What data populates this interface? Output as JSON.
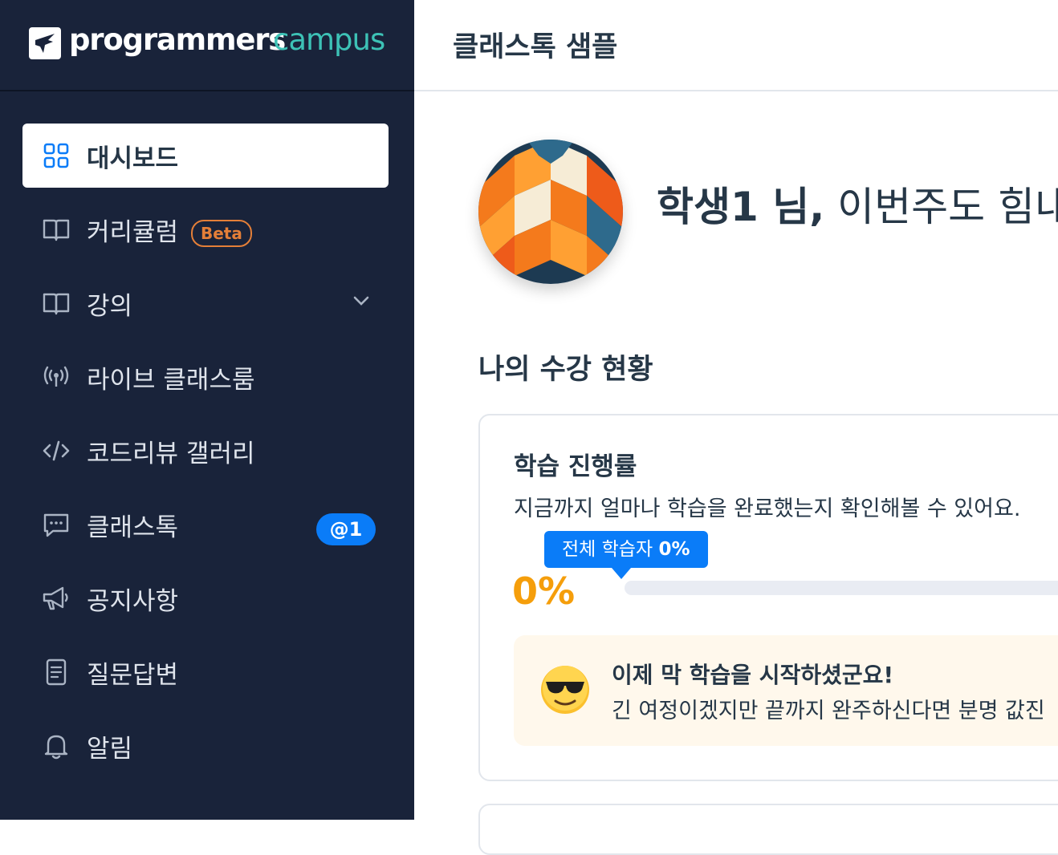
{
  "brand": {
    "word1": "programmers",
    "word2": "campus",
    "accent": "#3dc2b6"
  },
  "sidebar": {
    "background": "#19233a",
    "items": [
      {
        "label": "대시보드",
        "icon": "dashboard-grid-icon",
        "active": true
      },
      {
        "label": "커리큘럼",
        "icon": "open-book-icon",
        "badge": "Beta"
      },
      {
        "label": "강의",
        "icon": "open-book-icon",
        "expandable": true
      },
      {
        "label": "라이브 클래스룸",
        "icon": "broadcast-icon"
      },
      {
        "label": "코드리뷰 갤러리",
        "icon": "code-icon"
      },
      {
        "label": "클래스톡",
        "icon": "chat-icon",
        "mention_badge": "@1"
      },
      {
        "label": "공지사항",
        "icon": "megaphone-icon"
      },
      {
        "label": "질문답변",
        "icon": "document-icon"
      },
      {
        "label": "알림",
        "icon": "bell-icon"
      }
    ]
  },
  "header": {
    "title": "클래스톡 샘플"
  },
  "profile": {
    "name": "학생1 님,",
    "message": " 이번주도 힘내"
  },
  "section": {
    "title": "나의 수강 현황"
  },
  "progress_card": {
    "title": "학습 진행률",
    "description": "지금까지 얼마나 학습을 완료했는지 확인해볼 수 있어요.",
    "tooltip_label": "전체 학습자",
    "tooltip_value": "0%",
    "percent_text": "0%",
    "progress": 0,
    "notice_title": "이제 막 학습을 시작하셨군요!",
    "notice_text": "긴 여정이겠지만 끝까지 완주하신다면 분명 값진"
  },
  "colors": {
    "primary": "#0a7cf8",
    "highlight": "#f59e0b",
    "beta": "#e47f38"
  }
}
